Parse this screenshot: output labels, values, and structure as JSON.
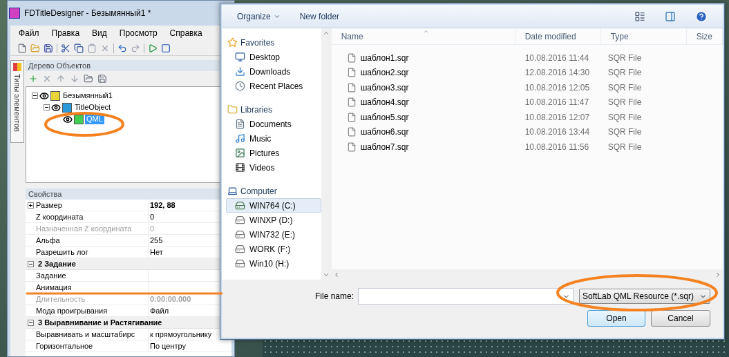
{
  "app": {
    "title": "FDTitleDesigner - Безымянный1 *",
    "menu": [
      "Файл",
      "Правка",
      "Вид",
      "Просмотр",
      "Справка"
    ],
    "side_tab": {
      "label": "Типы элементов"
    },
    "tree_panel": {
      "title": "Дерево Объектов"
    },
    "tree": [
      {
        "label": "Безымянный1",
        "kind": "project",
        "selected": false,
        "expanded": true,
        "children": [
          {
            "label": "TitleObject",
            "kind": "object",
            "selected": false,
            "expanded": true,
            "children": [
              {
                "label": "QML",
                "kind": "qml",
                "selected": true
              }
            ]
          }
        ]
      }
    ],
    "properties": {
      "title": "Свойства",
      "rows": [
        {
          "kind": "prop",
          "name": "Размер",
          "value": "192, 88",
          "expanded": false,
          "bold_value": true,
          "disabled": false
        },
        {
          "kind": "prop",
          "name": "Z координата",
          "value": "0",
          "bold_value": false,
          "disabled": false
        },
        {
          "kind": "prop",
          "name": "Назначенная Z координата",
          "value": "0",
          "bold_value": false,
          "disabled": true
        },
        {
          "kind": "prop",
          "name": "Альфа",
          "value": "255",
          "bold_value": false,
          "disabled": false
        },
        {
          "kind": "prop",
          "name": "Разрешить лог",
          "value": "Нет",
          "bold_value": false,
          "disabled": false
        },
        {
          "kind": "group",
          "name": "2 Задание",
          "expanded": true
        },
        {
          "kind": "prop",
          "name": "Задание",
          "value": "",
          "disabled": false
        },
        {
          "kind": "prop",
          "name": "Анимация",
          "value": "",
          "disabled": false
        },
        {
          "kind": "prop",
          "name": "Длительность",
          "value": "0:00:00.000",
          "bold_value": true,
          "disabled": true
        },
        {
          "kind": "prop",
          "name": "Мода проигрывания",
          "value": "Файл",
          "bold_value": false,
          "disabled": false
        },
        {
          "kind": "group",
          "name": "3 Выравнивание и Растягивание",
          "expanded": true
        },
        {
          "kind": "prop",
          "name": "Выравнивать и масштабирс",
          "value": "к прямоугольнику",
          "bold_value": false,
          "disabled": false
        },
        {
          "kind": "prop",
          "name": "Горизонтальное",
          "value": "По центру",
          "bold_value": false,
          "disabled": false
        }
      ]
    }
  },
  "dialog": {
    "toolbar": {
      "organize": "Organize",
      "new_folder": "New folder"
    },
    "nav": [
      {
        "label": "Favorites",
        "kind": "star",
        "items": [
          {
            "label": "Desktop",
            "kind": "desktop",
            "selected": false
          },
          {
            "label": "Downloads",
            "kind": "downloads",
            "selected": false
          },
          {
            "label": "Recent Places",
            "kind": "recent",
            "selected": false
          }
        ]
      },
      {
        "label": "Libraries",
        "kind": "library",
        "items": [
          {
            "label": "Documents",
            "kind": "document",
            "selected": false
          },
          {
            "label": "Music",
            "kind": "music",
            "selected": false
          },
          {
            "label": "Pictures",
            "kind": "pictures",
            "selected": false
          },
          {
            "label": "Videos",
            "kind": "videos",
            "selected": false
          }
        ]
      },
      {
        "label": "Computer",
        "kind": "computer",
        "items": [
          {
            "label": "WIN764 (C:)",
            "kind": "system-drive",
            "selected": true
          },
          {
            "label": "WINXP (D:)",
            "kind": "drive",
            "selected": false
          },
          {
            "label": "WIN732 (E:)",
            "kind": "drive",
            "selected": false
          },
          {
            "label": "WORK (F:)",
            "kind": "drive",
            "selected": false
          },
          {
            "label": "Win10 (H:)",
            "kind": "drive",
            "selected": false
          }
        ]
      }
    ],
    "columns": [
      {
        "label": "Name",
        "sorted": true
      },
      {
        "label": "Date modified",
        "sorted": false
      },
      {
        "label": "Type",
        "sorted": false
      },
      {
        "label": "Size",
        "sorted": false
      }
    ],
    "files": [
      {
        "name": "шаблон1.sqr",
        "date": "10.08.2016 11:44",
        "type": "SQR File"
      },
      {
        "name": "шаблон2.sqr",
        "date": "12.08.2016 14:30",
        "type": "SQR File"
      },
      {
        "name": "шаблон3.sqr",
        "date": "10.08.2016 12:05",
        "type": "SQR File"
      },
      {
        "name": "шаблон4.sqr",
        "date": "10.08.2016 11:47",
        "type": "SQR File"
      },
      {
        "name": "шаблон5.sqr",
        "date": "10.08.2016 12:07",
        "type": "SQR File"
      },
      {
        "name": "шаблон6.sqr",
        "date": "10.08.2016 13:44",
        "type": "SQR File"
      },
      {
        "name": "шаблон7.sqr",
        "date": "10.08.2016 11:56",
        "type": "SQR File"
      }
    ],
    "file_name_label": "File name:",
    "filter": "SoftLab QML Resource (*.sqr)",
    "buttons": [
      {
        "label": "Open",
        "default": true
      },
      {
        "label": "Cancel",
        "default": false
      }
    ]
  }
}
